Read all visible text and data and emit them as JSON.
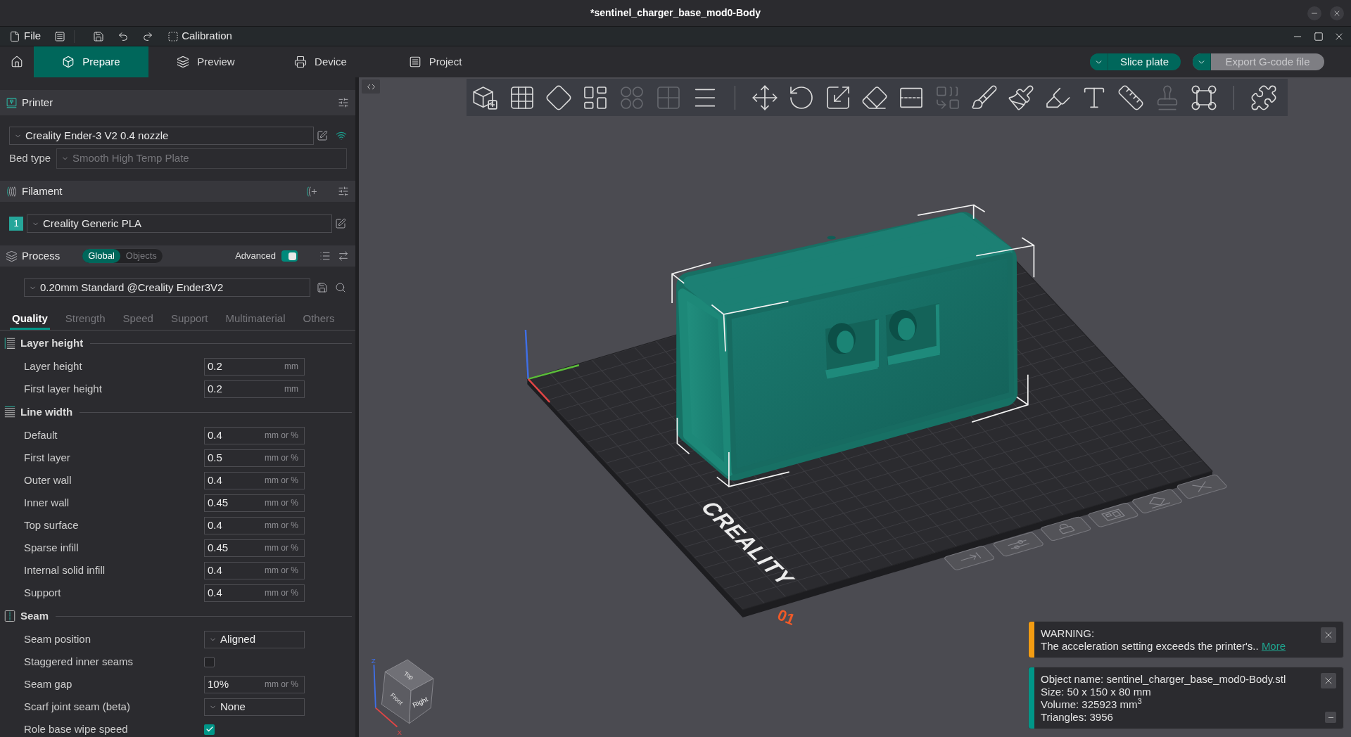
{
  "window": {
    "title": "*sentinel_charger_base_mod0-Body"
  },
  "menu_bar": {
    "file": "File",
    "calibration": "Calibration"
  },
  "tabs": [
    {
      "label": "Prepare",
      "selected": true
    },
    {
      "label": "Preview",
      "selected": false
    },
    {
      "label": "Device",
      "selected": false
    },
    {
      "label": "Project",
      "selected": false
    }
  ],
  "actions": [
    {
      "label": "Slice plate",
      "disabled": false
    },
    {
      "label": "Export G-code file",
      "disabled": true
    }
  ],
  "printer": {
    "title": "Printer",
    "preset": "Creality Ender-3 V2 0.4 nozzle",
    "bed_type": {
      "label": "Bed type",
      "value": "Smooth High Temp Plate",
      "disabled": true
    }
  },
  "filament": {
    "title": "Filament",
    "slots": [
      {
        "number": "1",
        "preset": "Creality Generic PLA",
        "color": "#26a69a"
      }
    ]
  },
  "process": {
    "title": "Process",
    "scope": [
      {
        "label": "Global",
        "selected": true
      },
      {
        "label": "Objects",
        "selected": false
      }
    ],
    "advanced": {
      "label": "Advanced",
      "on": true
    },
    "preset": "0.20mm Standard @Creality Ender3V2"
  },
  "settings_tabs": [
    {
      "label": "Quality",
      "selected": true
    },
    {
      "label": "Strength",
      "selected": false
    },
    {
      "label": "Speed",
      "selected": false
    },
    {
      "label": "Support",
      "selected": false
    },
    {
      "label": "Multimaterial",
      "selected": false
    },
    {
      "label": "Others",
      "selected": false
    }
  ],
  "settings": [
    {
      "title": "Layer height",
      "options": [
        {
          "kind": "number",
          "label": "Layer height",
          "value": "0.2",
          "unit": "mm"
        },
        {
          "kind": "number",
          "label": "First layer height",
          "value": "0.2",
          "unit": "mm"
        }
      ]
    },
    {
      "title": "Line width",
      "options": [
        {
          "kind": "number",
          "label": "Default",
          "value": "0.4",
          "unit": "mm or %"
        },
        {
          "kind": "number",
          "label": "First layer",
          "value": "0.5",
          "unit": "mm or %"
        },
        {
          "kind": "number",
          "label": "Outer wall",
          "value": "0.4",
          "unit": "mm or %"
        },
        {
          "kind": "number",
          "label": "Inner wall",
          "value": "0.45",
          "unit": "mm or %"
        },
        {
          "kind": "number",
          "label": "Top surface",
          "value": "0.4",
          "unit": "mm or %"
        },
        {
          "kind": "number",
          "label": "Sparse infill",
          "value": "0.45",
          "unit": "mm or %"
        },
        {
          "kind": "number",
          "label": "Internal solid infill",
          "value": "0.4",
          "unit": "mm or %"
        },
        {
          "kind": "number",
          "label": "Support",
          "value": "0.4",
          "unit": "mm or %"
        }
      ]
    },
    {
      "title": "Seam",
      "options": [
        {
          "kind": "select",
          "label": "Seam position",
          "value": "Aligned"
        },
        {
          "kind": "checkbox",
          "label": "Staggered inner seams",
          "checked": false
        },
        {
          "kind": "number",
          "label": "Seam gap",
          "value": "10%",
          "unit": "mm or %"
        },
        {
          "kind": "select",
          "label": "Scarf joint seam (beta)",
          "value": "None"
        },
        {
          "kind": "checkbox",
          "label": "Role base wipe speed",
          "checked": true
        }
      ]
    }
  ],
  "toolbar": {
    "groups": [
      {
        "tools": [
          {
            "kind": "add_object",
            "disabled": false
          },
          {
            "kind": "add_plate",
            "disabled": false
          },
          {
            "kind": "auto_orient",
            "disabled": false
          },
          {
            "kind": "arrange",
            "disabled": false
          },
          {
            "kind": "split_objects",
            "disabled": true
          },
          {
            "kind": "split_parts",
            "disabled": true
          },
          {
            "kind": "variable_layer_height",
            "disabled": false
          }
        ]
      },
      {
        "tools": [
          {
            "kind": "move",
            "disabled": false
          },
          {
            "kind": "rotate",
            "disabled": false
          },
          {
            "kind": "scale",
            "disabled": false
          },
          {
            "kind": "lay_on_face",
            "disabled": false
          },
          {
            "kind": "cut",
            "disabled": false
          },
          {
            "kind": "mesh_boolean",
            "disabled": true
          },
          {
            "kind": "support_painting",
            "disabled": false
          },
          {
            "kind": "seam_painting",
            "disabled": false
          },
          {
            "kind": "mmu_painting",
            "disabled": false
          },
          {
            "kind": "text",
            "disabled": false
          },
          {
            "kind": "measure",
            "disabled": false
          },
          {
            "kind": "emboss",
            "disabled": true
          },
          {
            "kind": "brim_ears",
            "disabled": false
          }
        ]
      },
      {
        "tools": [
          {
            "kind": "assembly",
            "disabled": false
          }
        ]
      }
    ]
  },
  "viewport": {
    "bed_logo": "CREALITY",
    "plate_number": "01",
    "view_cube": {
      "top": "Top",
      "front": "Front",
      "right": "Right",
      "z_axis": "Z",
      "x_axis": "X"
    }
  },
  "notifications": [
    {
      "kind": "warning",
      "color": "#f39c12",
      "title": "WARNING:",
      "message": "The acceleration setting exceeds the printer's..",
      "link": "More"
    },
    {
      "kind": "info",
      "color": "#009688",
      "lines": [
        "Object name: sentinel_charger_base_mod0-Body.stl",
        "Size: 50 x 150 x 80 mm",
        "Volume: 325923 mm$^{3}$",
        "Triangles: 3956"
      ]
    }
  ]
}
